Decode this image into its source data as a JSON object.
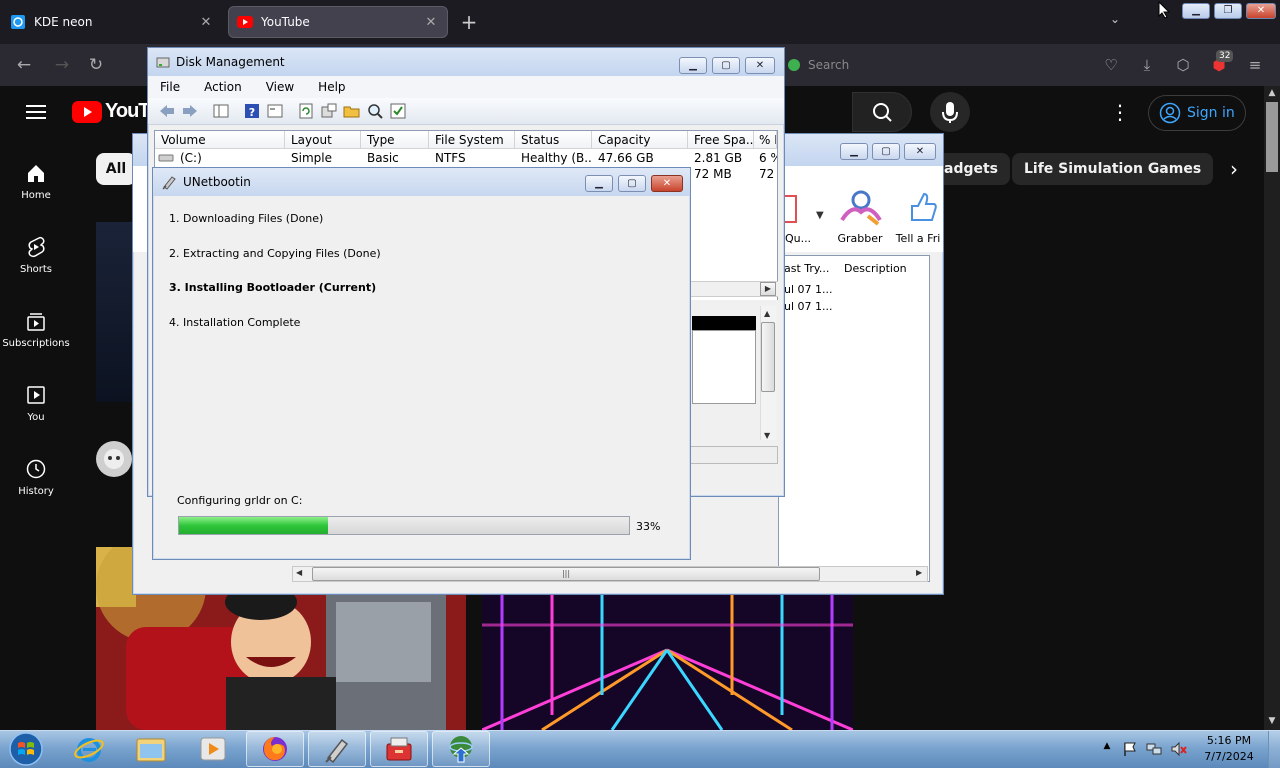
{
  "browser": {
    "tabs": [
      {
        "label": "KDE neon"
      },
      {
        "label": "YouTube"
      }
    ],
    "url_placeholder": "Search",
    "extension_badge": "32"
  },
  "youtube": {
    "logo": "YouTube",
    "sign_in": "Sign in",
    "sidebar": [
      {
        "label": "Home"
      },
      {
        "label": "Shorts"
      },
      {
        "label": "Subscriptions"
      },
      {
        "label": "You"
      },
      {
        "label": "History"
      }
    ],
    "chips": {
      "all": "All",
      "partial": "adgets",
      "life_sim": "Life Simulation Games"
    }
  },
  "background_dialog": {
    "tools": [
      "Qu...",
      "Grabber",
      "Tell a Fri"
    ],
    "columns": [
      "ast Try...",
      "Description"
    ],
    "rows": [
      "ul 07 1...",
      "ul 07 1..."
    ]
  },
  "disk_management": {
    "title": "Disk Management",
    "menu": [
      "File",
      "Action",
      "View",
      "Help"
    ],
    "columns": [
      "Volume",
      "Layout",
      "Type",
      "File System",
      "Status",
      "Capacity",
      "Free Spa...",
      "% F"
    ],
    "rows": [
      {
        "volume": "(C:)",
        "layout": "Simple",
        "type": "Basic",
        "fs": "NTFS",
        "status": "Healthy (B...",
        "capacity": "47.66 GB",
        "free": "2.81 GB",
        "pct": "6 %"
      },
      {
        "free": "72 MB",
        "pct": "72"
      }
    ]
  },
  "unetbootin": {
    "title": "UNetbootin",
    "steps": [
      "1. Downloading Files (Done)",
      "2. Extracting and Copying Files (Done)",
      "3. Installing Bootloader (Current)",
      "4. Installation Complete"
    ],
    "progress_label": "Configuring grldr on C:",
    "progress_text": "33%",
    "progress_value": 0.33
  },
  "taskbar": {
    "time": "5:16 PM",
    "date": "7/7/2024"
  }
}
